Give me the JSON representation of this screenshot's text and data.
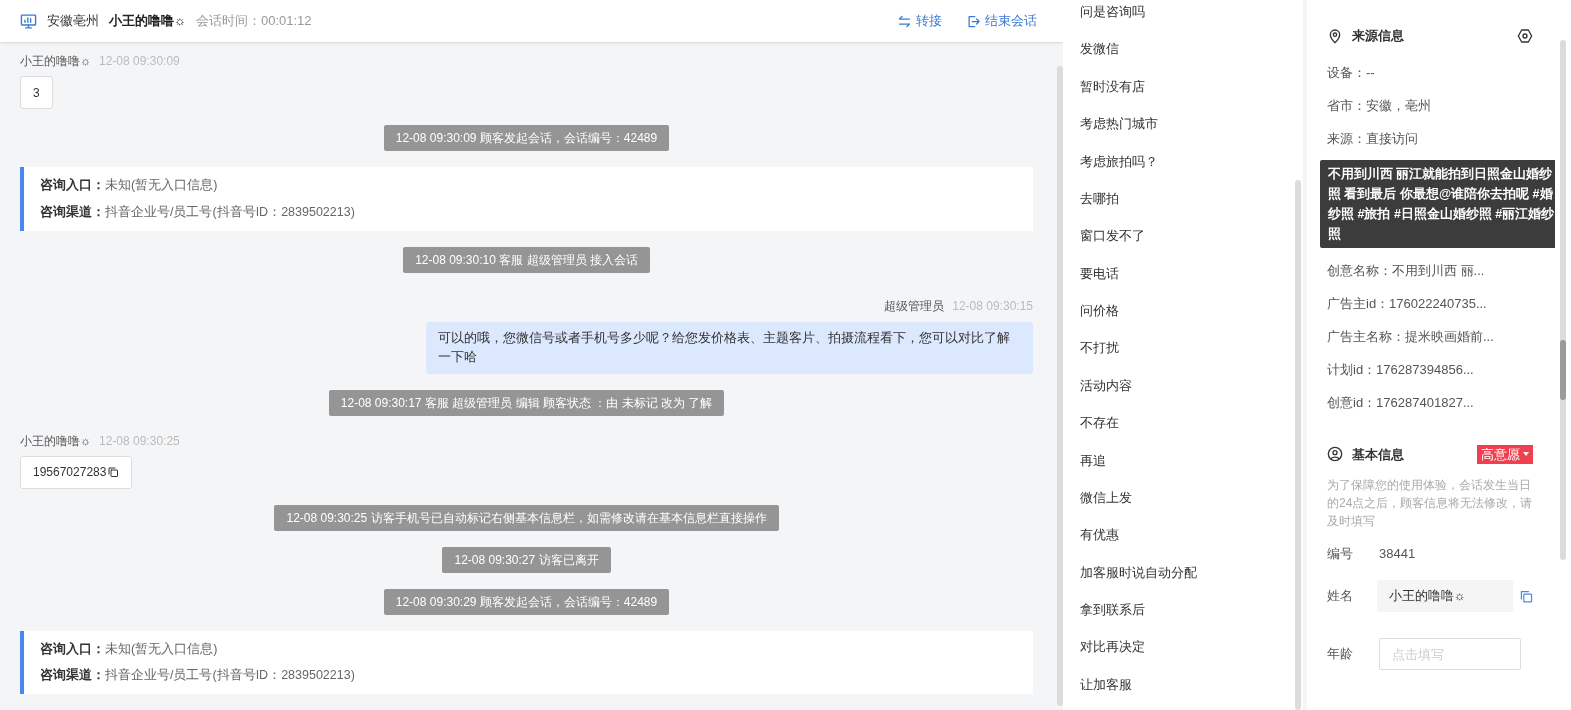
{
  "header": {
    "location": "安徽亳州",
    "customer": "小王的噜噜☼",
    "duration": "会话时间：00:01:12",
    "actions": [
      {
        "kind": "transfer",
        "label": "转接"
      },
      {
        "kind": "end",
        "label": "结束会话"
      }
    ]
  },
  "messages": [
    {
      "kind": "customer",
      "name": "小王的噜噜☼",
      "time": "12-08 09:30:09",
      "text": "3",
      "copy": false
    },
    {
      "kind": "system",
      "text": "12-08 09:30:09 顾客发起会话，会话编号：42489"
    },
    {
      "kind": "info",
      "entry_label": "咨询入口：",
      "entry_value": "未知(暂无入口信息)",
      "channel_label": "咨询渠道：",
      "channel_value": "抖音企业号/员工号(抖音号ID：2839502213)"
    },
    {
      "kind": "system",
      "text": "12-08 09:30:10 客服 超级管理员 接入会话"
    },
    {
      "kind": "agent",
      "name": "超级管理员",
      "time": "12-08 09:30:15",
      "text": "可以的哦，您微信号或者手机号多少呢？给您发价格表、主题客片、拍摄流程看下，您可以对比了解一下哈"
    },
    {
      "kind": "system",
      "text": "12-08 09:30:17 客服 超级管理员 编辑 顾客状态 ：由 未标记 改为 了解"
    },
    {
      "kind": "customer",
      "name": "小王的噜噜☼",
      "time": "12-08 09:30:25",
      "text": "19567027283",
      "copy": true
    },
    {
      "kind": "system",
      "text": "12-08 09:30:25 访客手机号已自动标记右侧基本信息栏，如需修改请在基本信息栏直接操作"
    },
    {
      "kind": "system",
      "text": "12-08 09:30:27 访客已离开"
    },
    {
      "kind": "system",
      "text": "12-08 09:30:29 顾客发起会话，会话编号：42489"
    },
    {
      "kind": "info",
      "entry_label": "咨询入口：",
      "entry_value": "未知(暂无入口信息)",
      "channel_label": "咨询渠道：",
      "channel_value": "抖音企业号/员工号(抖音号ID：2839502213)"
    }
  ],
  "quick_replies": [
    "问是咨询吗",
    "发微信",
    "暂时没有店",
    "考虑热门城市",
    "考虑旅拍吗？",
    "去哪拍",
    "窗口发不了",
    "要电话",
    "问价格",
    "不打扰",
    "活动内容",
    "不存在",
    "再追",
    "微信上发",
    "有优惠",
    "加客服时说自动分配",
    "拿到联系后",
    "对比再决定",
    "让加客服"
  ],
  "source": {
    "title": "来源信息",
    "rows_top": [
      "设备：--",
      "省市：安徽，亳州",
      "来源：直接访问"
    ],
    "tooltip": "不用到川西 丽江就能拍到日照金山婚纱照 看到最后 你最想@谁陪你去拍呢 #婚纱照 #旅拍 #日照金山婚纱照 #丽江婚纱照",
    "rows_bottom": [
      "创意名称：不用到川西 丽...",
      "广告主id：176022240735...",
      "广告主名称：提米映画婚前...",
      "计划id：176287394856...",
      "创意id：176287401827..."
    ]
  },
  "basic": {
    "title": "基本信息",
    "badge": "高意愿",
    "note": "为了保障您的使用体验，会话发生当日的24点之后，顾客信息将无法修改，请及时填写",
    "fields": [
      {
        "kind": "text",
        "label": "编号",
        "value": "38441"
      },
      {
        "kind": "copy",
        "label": "姓名",
        "value": "小王的噜噜☼"
      },
      {
        "kind": "input",
        "label": "年龄",
        "placeholder": "点击填写"
      }
    ]
  }
}
